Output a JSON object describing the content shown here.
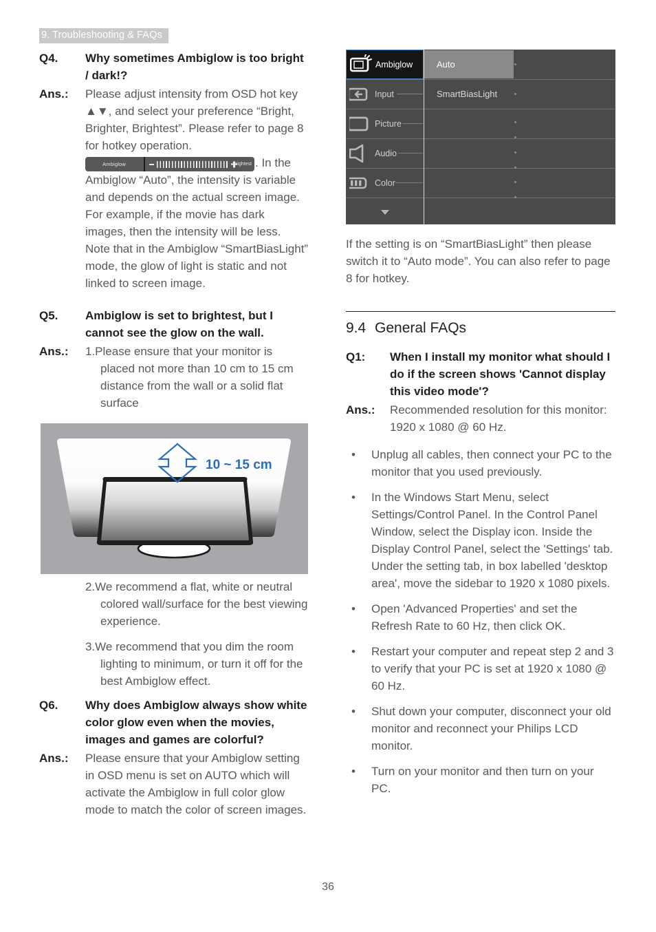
{
  "running_head": "9. Troubleshooting & FAQs",
  "page_number": "36",
  "left_column": {
    "q4": {
      "tag": "Q4.",
      "question": "Why sometimes Ambiglow is too bright / dark!?",
      "ans_tag": "Ans.:",
      "answer_part1": "Please adjust intensity from OSD hot key ▲▼, and select your preference “Bright, Brighter, Brightest”.  Please refer to page 8 for hotkey operation.",
      "answer_part2": ". In the Ambiglow “Auto”, the intensity is variable and depends on the actual screen image. For example, if the movie has dark images, then the intensity will be less. Note that in the Ambiglow “SmartBiasLight” mode, the glow of light is static and not linked to screen image.",
      "osd_bar": {
        "label": "Ambiglow",
        "minus": "−",
        "plus": "+",
        "right_label": "Brightest"
      }
    },
    "q5": {
      "tag": "Q5.",
      "question": "Ambiglow is set to brightest, but I cannot see the glow on the wall.",
      "ans_tag": "Ans.:",
      "items": [
        "1.Please ensure that your monitor is placed not more than 10 cm to 15 cm distance from the wall or a solid flat surface",
        "2.We recommend a flat, white or neutral colored wall/surface for the best viewing experience.",
        "3.We recommend that you dim the room lighting to minimum, or turn it off for the best Ambiglow effect."
      ]
    },
    "illustration": {
      "distance_label": "10 ~ 15 cm",
      "accent_color": "#2a6ebb",
      "background_color": "#a6a8ab"
    },
    "q6": {
      "tag": "Q6.",
      "question": "Why does Ambiglow always show white color glow even when the movies, images and games are colorful?",
      "ans_tag": "Ans.:",
      "answer": "Please ensure that your Ambiglow setting in OSD menu is set on AUTO which will activate the Ambiglow in full color glow mode to match the color of screen images."
    }
  },
  "right_column": {
    "osd_menu": {
      "menu_items": [
        {
          "label": "Ambiglow",
          "icon": "ambiglow-monitor-icon",
          "active": true
        },
        {
          "label": "Input",
          "icon": "input-arrow-icon",
          "active": false
        },
        {
          "label": "Picture",
          "icon": "picture-monitor-icon",
          "active": false
        },
        {
          "label": "Audio",
          "icon": "speaker-icon",
          "active": false
        },
        {
          "label": "Color",
          "icon": "color-bars-icon",
          "active": false
        }
      ],
      "scroll_down_icon": "chevron-down-icon",
      "options": [
        {
          "label": "Auto",
          "selected": true
        },
        {
          "label": "SmartBiasLight",
          "selected": false
        }
      ],
      "highlight_color": "#8a8a8a",
      "focus_border_color": "#4a86c8",
      "panel_color": "#4a4a4a"
    },
    "osd_caption": "If the setting is on “SmartBiasLight” then please switch it to “Auto mode”. You can also refer to page 8 for hotkey.",
    "section": {
      "number": "9.4",
      "title": "General FAQs"
    },
    "q1": {
      "tag": "Q1:",
      "question": "When I install my monitor what should I do if the screen shows 'Cannot display this video mode'?",
      "ans_tag": "Ans.:",
      "answer": "Recommended resolution for this monitor: 1920 x 1080 @ 60 Hz."
    },
    "bullets": [
      {
        "marker": "•",
        "text": "Unplug all cables, then connect your PC to the monitor that you used previously."
      },
      {
        "marker": "•",
        "text": "In the Windows Start Menu, select Settings/Control Panel. In the Control Panel Window, select the Display icon. Inside the Display Control Panel, select the 'Settings' tab. Under the setting tab, in box labelled 'desktop area', move the sidebar to 1920 x 1080 pixels."
      },
      {
        "marker": "•",
        "text": "Open 'Advanced Properties' and set the Refresh Rate to 60 Hz, then click OK."
      },
      {
        "marker": "•",
        "text": "Restart your computer and repeat step 2 and 3 to verify that your PC is set at 1920 x 1080 @ 60 Hz."
      },
      {
        "marker": "•",
        "text": "Shut down your computer, disconnect your old monitor and reconnect your Philips LCD monitor."
      },
      {
        "marker": "•",
        "text": "Turn on your monitor and then turn on your PC."
      }
    ]
  }
}
